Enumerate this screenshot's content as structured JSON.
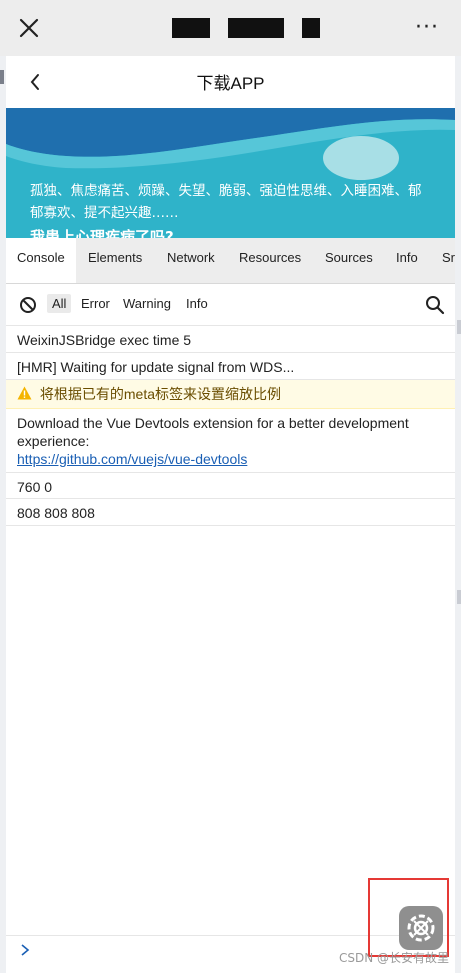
{
  "wechat_bar": {
    "close_icon": "close-icon",
    "more_label": "···"
  },
  "app_header": {
    "title": "下载APP",
    "back_icon": "chevron-left-icon"
  },
  "banner": {
    "text": "孤独、焦虑痛苦、烦躁、失望、脆弱、强迫性思维、入睡困难、郁郁寡欢、提不起兴趣……",
    "cut_text": "我患上心理疾病了吗?",
    "color": "#2fb3c9"
  },
  "devtools": {
    "tabs": [
      "Console",
      "Elements",
      "Network",
      "Resources",
      "Sources",
      "Info",
      "Sr"
    ],
    "active_tab": "Console",
    "filters": [
      "All",
      "Error",
      "Warning",
      "Info"
    ],
    "active_filter": "All",
    "logs": [
      {
        "text": "WeixinJSBridge exec time 5",
        "level": "log"
      },
      {
        "text": "[HMR] Waiting for update signal from WDS...",
        "level": "log"
      },
      {
        "text": "将根据已有的meta标签来设置缩放比例",
        "level": "warn"
      },
      {
        "text": "Download the Vue Devtools extension for a better development experience:",
        "link": "https://github.com/vuejs/vue-devtools",
        "level": "log"
      },
      {
        "text": "760 0",
        "level": "log"
      },
      {
        "text": "808 808 808",
        "level": "log"
      }
    ],
    "prompt_icon": "chevron-right-icon"
  },
  "vconsole_button": {
    "icon": "settings-gear-icon"
  },
  "watermark": "CSDN @长安有故里"
}
